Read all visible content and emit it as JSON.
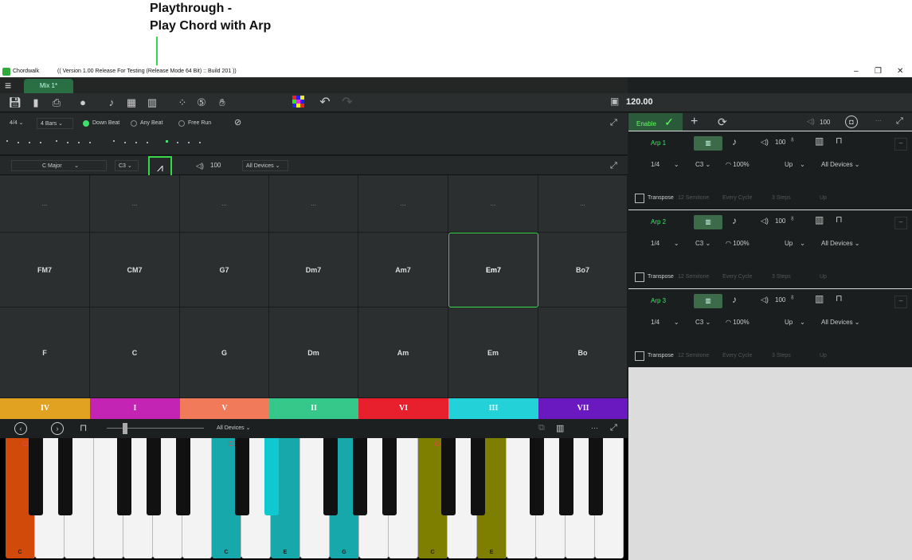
{
  "annotation": {
    "line1": "Playthrough -",
    "line2": "Play Chord with Arp"
  },
  "window": {
    "app_name": "Chordwalk",
    "version": "((  Version 1.00 Release For Testing   (Release Mode 64 Bit)  :: Build 201   ))",
    "minimize": "–",
    "maximize": "❐",
    "close": "✕"
  },
  "tabs": [
    {
      "label": "Mix 1*"
    }
  ],
  "toolbar": {
    "tempo": "120.00"
  },
  "beat_bar": {
    "time_signature": "4/4",
    "bars": "4 Bars",
    "options": [
      {
        "label": "Down Beat",
        "selected": true
      },
      {
        "label": "Any Beat",
        "selected": false
      },
      {
        "label": "Free Run",
        "selected": false
      }
    ]
  },
  "key_bar": {
    "scale": "C Major",
    "octave": "C3",
    "volume": "100",
    "device": "All Devices"
  },
  "chord_grid": {
    "top_row": [
      "...",
      "...",
      "...",
      "...",
      "...",
      "...",
      "..."
    ],
    "seventh_row": [
      "FM7",
      "CM7",
      "G7",
      "Dm7",
      "Am7",
      "Em7",
      "Bo7"
    ],
    "triad_row": [
      "F",
      "C",
      "G",
      "Dm",
      "Am",
      "Em",
      "Bo"
    ],
    "highlighted": "Em7"
  },
  "degrees": [
    {
      "label": "IV",
      "color": "#e0a220"
    },
    {
      "label": "I",
      "color": "#c424b4"
    },
    {
      "label": "V",
      "color": "#f07a5a"
    },
    {
      "label": "II",
      "color": "#36c88a"
    },
    {
      "label": "VI",
      "color": "#e8202e"
    },
    {
      "label": "III",
      "color": "#22d2d8"
    },
    {
      "label": "VII",
      "color": "#6a18c0"
    }
  ],
  "keyboard_bar": {
    "device": "All Devices",
    "more": "···"
  },
  "keyboard": {
    "octave_labels": [
      "C2",
      "C3",
      "C4"
    ],
    "white_keys": [
      "C",
      "",
      "",
      "",
      "",
      "",
      "",
      "C",
      "",
      "E",
      "",
      "G",
      "",
      "",
      "C",
      "",
      "E",
      "",
      "",
      "",
      ""
    ],
    "colors": {
      "c2": "#d24a0a",
      "c3": "#16a8aa",
      "c4": "#7e7e00"
    }
  },
  "arp_panel": {
    "enable_label": "Enable",
    "volume": "100",
    "more": "···",
    "arps": [
      {
        "name": "Arp 1",
        "volume": "100",
        "rate": "1/4",
        "octave": "C3",
        "gate": "100%",
        "direction": "Up",
        "device": "All Devices",
        "transpose": "Transpose",
        "semitone": "12 Semitone",
        "cycle": "Every Cycle",
        "steps": "3 Steps",
        "tdir": "Up"
      },
      {
        "name": "Arp 2",
        "volume": "100",
        "rate": "1/4",
        "octave": "C3",
        "gate": "100%",
        "direction": "Up",
        "device": "All Devices",
        "transpose": "Transpose",
        "semitone": "12 Semitone",
        "cycle": "Every Cycle",
        "steps": "3 Steps",
        "tdir": "Up"
      },
      {
        "name": "Arp 3",
        "volume": "100",
        "rate": "1/4",
        "octave": "C3",
        "gate": "100%",
        "direction": "Up",
        "device": "All Devices",
        "transpose": "Transpose",
        "semitone": "12 Semitone",
        "cycle": "Every Cycle",
        "steps": "3 Steps",
        "tdir": "Up"
      }
    ]
  }
}
